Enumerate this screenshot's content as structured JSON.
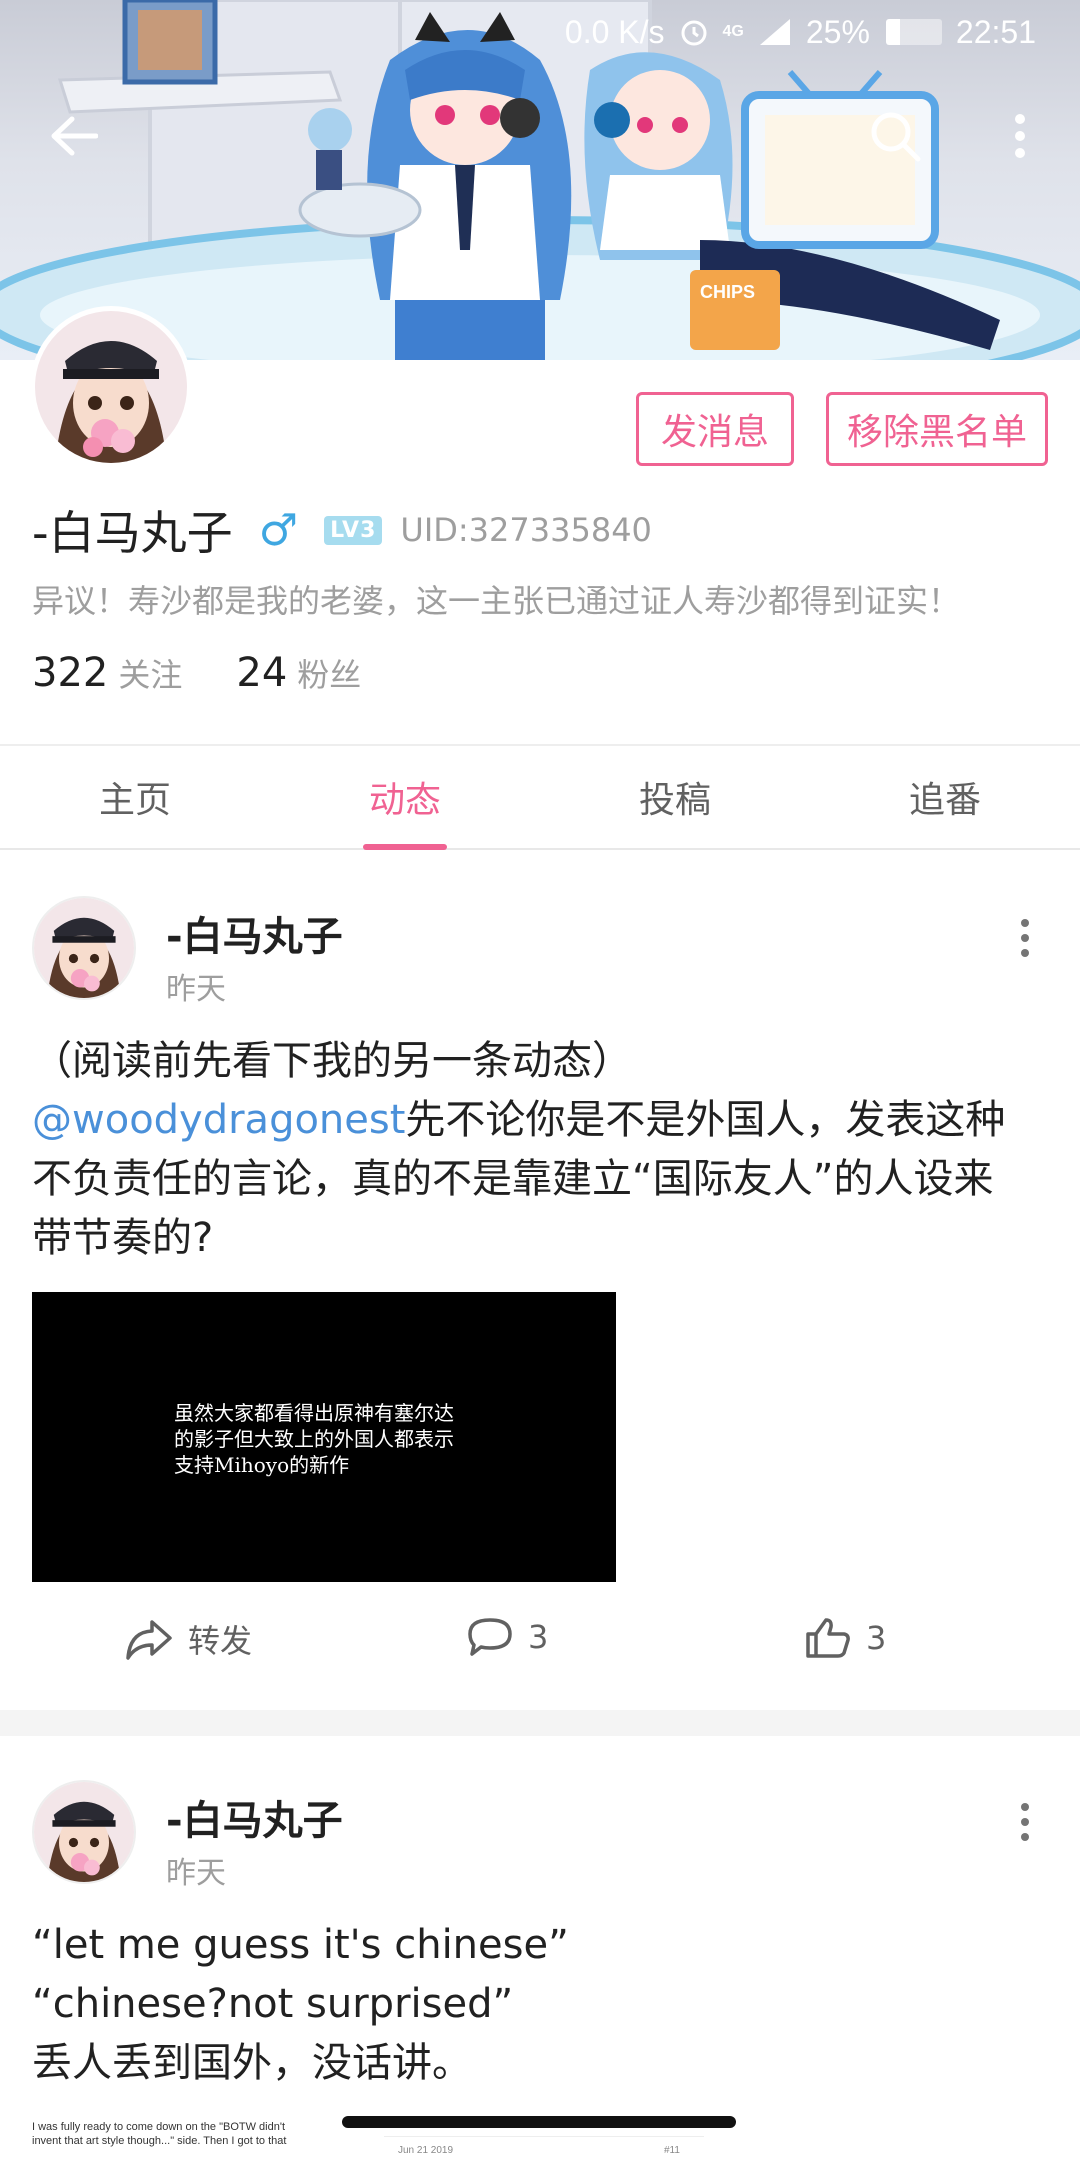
{
  "status_bar": {
    "network_speed": "0.0 K/s",
    "network_type": "4G",
    "battery": "25%",
    "time": "22:51"
  },
  "header": {
    "back_icon": "back-arrow-icon",
    "search_icon": "search-icon",
    "more_icon": "more-vertical-icon",
    "banner_text": "CHIPS"
  },
  "profile": {
    "username": "-白马丸子",
    "gender_symbol": "♂",
    "level": "LV3",
    "uid": "UID:327335840",
    "bio": "异议！寿沙都是我的老婆，这一主张已通过证人寿沙都得到证实！",
    "following_count": "322",
    "following_label": "关注",
    "followers_count": "24",
    "followers_label": "粉丝",
    "message_button": "发消息",
    "unblock_button": "移除黑名单"
  },
  "tabs": [
    {
      "label": "主页",
      "active": false
    },
    {
      "label": "动态",
      "active": true
    },
    {
      "label": "投稿",
      "active": false
    },
    {
      "label": "追番",
      "active": false
    }
  ],
  "colors": {
    "accent": "#f06292",
    "mention": "#4a90d9",
    "gender": "#3fa7e1"
  },
  "posts": [
    {
      "author": "-白马丸子",
      "time": "昨天",
      "text_line1": "（阅读前先看下我的另一条动态）",
      "mention": "@woodydragonest",
      "text_after_mention": "先不论你是不是外国人，发表这种",
      "text_line3": "不负责任的言论，真的不是靠建立“国际友人”的人设来",
      "text_line4": "带节奏的?",
      "video_caption": "虽然大家都看得出原神有塞尔达\n的影子但大致上的外国人都表示\n支持Mihoyo的新作",
      "share_label": "转发",
      "comment_count": "3",
      "like_count": "3"
    },
    {
      "author": "-白马丸子",
      "time": "昨天",
      "text_line1": "“let me guess it's chinese”",
      "text_line2": "“chinese?not surprised”",
      "text_line3": "丢人丢到国外，没话讲。",
      "preview_text_line1": "I was fully ready to come down on the \"BOTW didn't",
      "preview_text_line2": "invent that art style though...\" side. Then I got to that",
      "preview_date": "Jun 21 2019",
      "preview_number": "#11"
    }
  ]
}
